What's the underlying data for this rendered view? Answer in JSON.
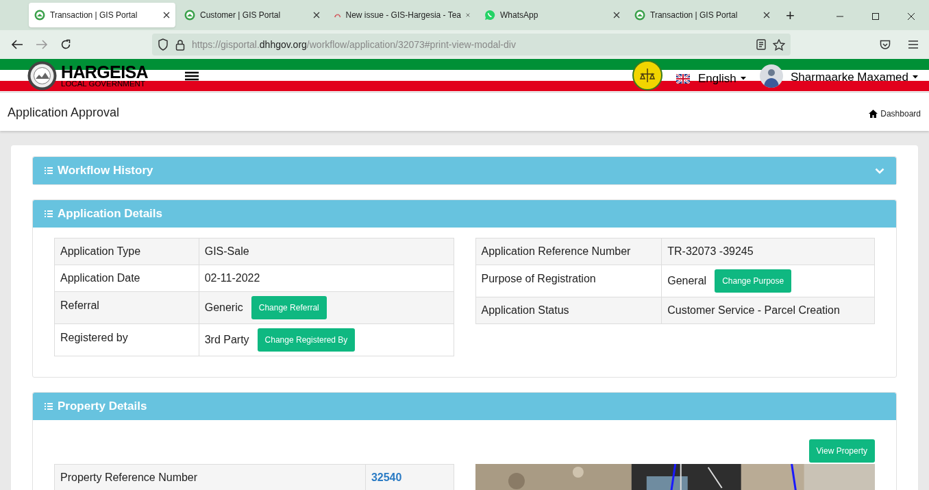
{
  "browser": {
    "tabs": [
      {
        "title": "Transaction | GIS Portal",
        "kind": "portal",
        "selected": true
      },
      {
        "title": "Customer | GIS Portal",
        "kind": "portal",
        "selected": false
      },
      {
        "title": "New issue - GIS-Hargesia - Tea",
        "kind": "tracker",
        "selected": false
      },
      {
        "title": "WhatsApp",
        "kind": "chat",
        "selected": false
      },
      {
        "title": "Transaction | GIS Portal",
        "kind": "portal",
        "selected": false
      }
    ],
    "new_tab": "+",
    "url": {
      "scheme": "https://gisportal.",
      "domain": "dhhgov.org",
      "path": "/workflow/application/32073#print-view-modal-div"
    }
  },
  "header": {
    "brand": "HARGEISA",
    "brand_sub": "LOCAL GOVERNMENT",
    "language": "English",
    "user": "Sharmaarke Maxamed"
  },
  "page": {
    "title": "Application Approval",
    "breadcrumb": "Dashboard"
  },
  "sections": [
    {
      "title": "Workflow History",
      "expanded": false
    },
    {
      "title": "Application Details",
      "expanded": true,
      "left": [
        {
          "label": "Application Type",
          "value": "GIS-Sale"
        },
        {
          "label": "Application Date",
          "value": "02-11-2022"
        },
        {
          "label": "Referral",
          "value": "Generic",
          "button": "Change Referral"
        },
        {
          "label": "Registered by",
          "value": "3rd Party",
          "button": "Change Registered By"
        }
      ],
      "right": [
        {
          "label": "Application Reference Number",
          "value": "TR-32073 -39245"
        },
        {
          "label": "Purpose of Registration",
          "value": "General",
          "button": "Change Purpose"
        },
        {
          "label": "Application Status",
          "value": "Customer Service - Parcel Creation"
        }
      ]
    },
    {
      "title": "Property Details",
      "expanded": true,
      "action": "View Property",
      "left": [
        {
          "label": "Property Reference Number",
          "value": "32540",
          "kind": "link"
        }
      ]
    }
  ]
}
